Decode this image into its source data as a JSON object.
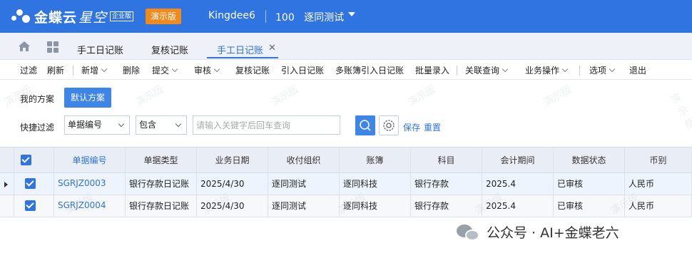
{
  "header": {
    "brand_name": "金蝶云",
    "brand_sub": "星空",
    "edition_badge": "企业版",
    "demo_label": "演示版",
    "tenant": "Kingdee6",
    "org_code": "100",
    "org_name": "逐同测试"
  },
  "tabs": [
    {
      "label": "手工日记账"
    },
    {
      "label": "复核记账"
    },
    {
      "label": "手工日记账",
      "active": true,
      "close": "✕"
    }
  ],
  "toolbar": {
    "items": [
      "过滤",
      "刷新",
      "新增",
      "删除",
      "提交",
      "审核",
      "复核记账",
      "引入日记账",
      "多账簿引入日记账",
      "批量录入",
      "关联查询",
      "业务操作",
      "选项",
      "退出"
    ]
  },
  "filter": {
    "scheme_label": "我的方案",
    "scheme_button": "默认方案",
    "quick_label": "快捷过滤",
    "field_select": "单据编号",
    "op_select": "包含",
    "search_placeholder": "请输入关键字后回车查询",
    "save_label": "保存",
    "reset_label": "重置"
  },
  "table": {
    "columns": [
      "单据编号",
      "单据类型",
      "业务日期",
      "收付组织",
      "账簿",
      "科目",
      "会计期间",
      "数据状态",
      "币别"
    ],
    "rows": [
      [
        "SGRJZ0003",
        "银行存款日记账",
        "2025/4/30",
        "逐同测试",
        "逐同科技",
        "银行存款",
        "2025.4",
        "已审核",
        "人民币"
      ],
      [
        "SGRJZ0004",
        "银行存款日记账",
        "2025/4/30",
        "逐同测试",
        "逐同科技",
        "银行存款",
        "2025.4",
        "已审核",
        "人民币"
      ]
    ]
  },
  "watermark": "演示版",
  "footer": {
    "brand": "公众号 · AI+金蝶老六"
  },
  "colors": {
    "primary": "#2f74e0",
    "demo_orange": "#f08a1c"
  }
}
